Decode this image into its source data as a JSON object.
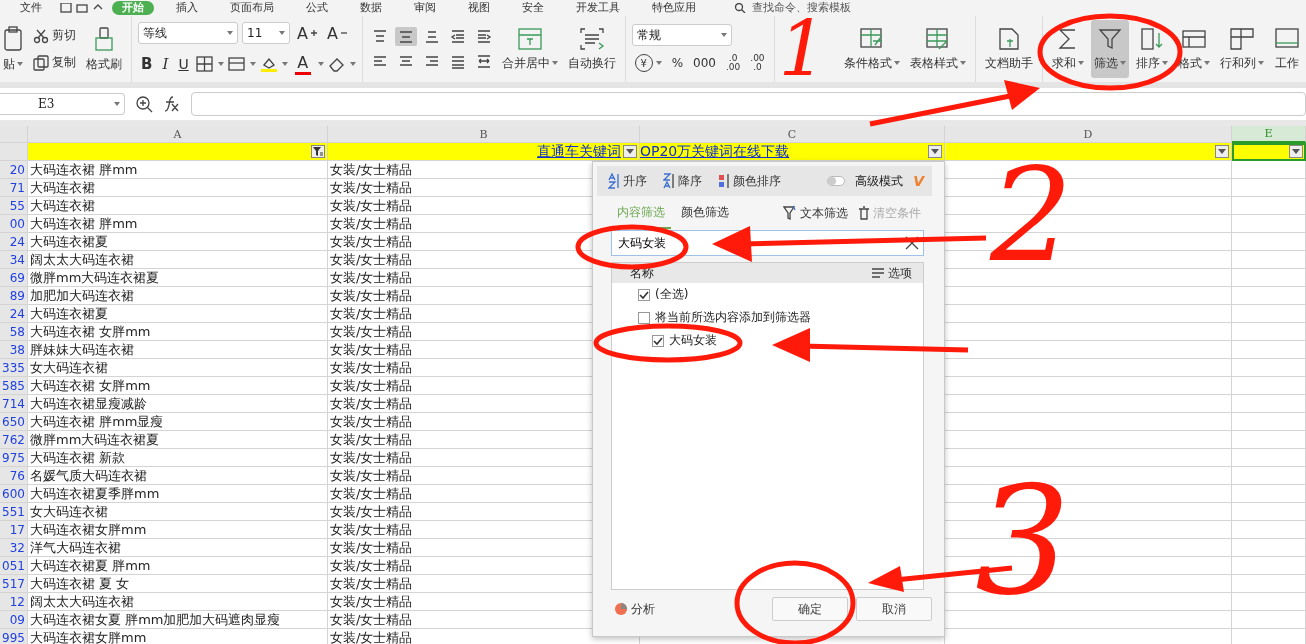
{
  "menu_bar": {
    "file": "文件",
    "tabs": [
      {
        "label": "开始",
        "selected": true
      },
      {
        "label": "插入",
        "selected": false
      },
      {
        "label": "页面布局",
        "selected": false
      },
      {
        "label": "公式",
        "selected": false
      },
      {
        "label": "数据",
        "selected": false
      },
      {
        "label": "审阅",
        "selected": false
      },
      {
        "label": "视图",
        "selected": false
      },
      {
        "label": "安全",
        "selected": false
      },
      {
        "label": "开发工具",
        "selected": false
      },
      {
        "label": "特色应用",
        "selected": false
      }
    ],
    "search_placeholder": "查找命令、搜索模板"
  },
  "ribbon": {
    "paste": "贴",
    "cut": "剪切",
    "copy": "复制",
    "format_painter": "格式刷",
    "font": "等线",
    "size": "11",
    "grow_font": "A",
    "shrink_font": "A",
    "font_style_buttons": [
      "B",
      "I",
      "U"
    ],
    "font_color": "A",
    "align_buttons": [
      {
        "selected": false
      },
      {
        "selected": true
      },
      {
        "selected": false
      },
      {
        "selected": false
      },
      {
        "selected": false
      },
      {
        "selected": false
      },
      {
        "selected": false
      },
      {
        "selected": false
      },
      {
        "selected": false
      },
      {
        "selected": false
      }
    ],
    "merge": "合并居中",
    "wrap": "自动换行",
    "number_format": "常规",
    "number_buttons": [
      {
        "kind": "currency",
        "label": "¥"
      },
      {
        "kind": "plain",
        "label": "%"
      },
      {
        "kind": "plain",
        "label": "000"
      },
      {
        "kind": "stack",
        "lines": [
          ".0",
          ".00"
        ]
      },
      {
        "kind": "stack",
        "lines": [
          ".00",
          ".0"
        ]
      }
    ],
    "tools": [
      {
        "label": "条件格式",
        "caret": true,
        "selected": false
      },
      {
        "label": "表格样式",
        "caret": true,
        "selected": false
      },
      {
        "label": "文档助手",
        "caret": false,
        "selected": false
      },
      {
        "label": "求和",
        "caret": true,
        "selected": false
      },
      {
        "label": "筛选",
        "caret": true,
        "selected": true
      },
      {
        "label": "排序",
        "caret": true,
        "selected": false
      },
      {
        "label": "格式",
        "caret": true,
        "selected": false
      },
      {
        "label": "行和列",
        "caret": true,
        "selected": false
      },
      {
        "label": "工作",
        "caret": false,
        "selected": false
      }
    ]
  },
  "formula_bar": {
    "name_box": "E3"
  },
  "sheet": {
    "columns": [
      {
        "label": "A",
        "selected": false
      },
      {
        "label": "B",
        "selected": false
      },
      {
        "label": "C",
        "selected": false
      },
      {
        "label": "D",
        "selected": false
      },
      {
        "label": "E",
        "selected": true
      }
    ],
    "title_row": {
      "left": "直通车关键词",
      "right": "OP20万关键词在线下载"
    },
    "rows": [
      {
        "number": "20",
        "keyword": "大码连衣裙 胖mm",
        "category": "女装/女士精品"
      },
      {
        "number": "71",
        "keyword": "大码连衣裙",
        "category": "女装/女士精品"
      },
      {
        "number": "55",
        "keyword": "大码连衣裙",
        "category": "女装/女士精品"
      },
      {
        "number": "00",
        "keyword": "大码连衣裙 胖mm",
        "category": "女装/女士精品"
      },
      {
        "number": "24",
        "keyword": "大码连衣裙夏",
        "category": "女装/女士精品"
      },
      {
        "number": "34",
        "keyword": "阔太太大码连衣裙",
        "category": "女装/女士精品"
      },
      {
        "number": "69",
        "keyword": "微胖mm大码连衣裙夏",
        "category": "女装/女士精品"
      },
      {
        "number": "89",
        "keyword": "加肥加大码连衣裙",
        "category": "女装/女士精品"
      },
      {
        "number": "24",
        "keyword": "大码连衣裙夏",
        "category": "女装/女士精品"
      },
      {
        "number": "58",
        "keyword": "大码连衣裙 女胖mm",
        "category": "女装/女士精品"
      },
      {
        "number": "38",
        "keyword": "胖妹妹大码连衣裙",
        "category": "女装/女士精品"
      },
      {
        "number": "335",
        "keyword": "女大码连衣裙",
        "category": "女装/女士精品"
      },
      {
        "number": "585",
        "keyword": "大码连衣裙 女胖mm",
        "category": "女装/女士精品"
      },
      {
        "number": "714",
        "keyword": "大码连衣裙显瘦减龄",
        "category": "女装/女士精品"
      },
      {
        "number": "650",
        "keyword": "大码连衣裙 胖mm显瘦",
        "category": "女装/女士精品"
      },
      {
        "number": "762",
        "keyword": "微胖mm大码连衣裙夏",
        "category": "女装/女士精品"
      },
      {
        "number": "975",
        "keyword": "大码连衣裙 新款",
        "category": "女装/女士精品"
      },
      {
        "number": "76",
        "keyword": "名媛气质大码连衣裙",
        "category": "女装/女士精品"
      },
      {
        "number": "600",
        "keyword": "大码连衣裙夏季胖mm",
        "category": "女装/女士精品"
      },
      {
        "number": "551",
        "keyword": "女大码连衣裙",
        "category": "女装/女士精品"
      },
      {
        "number": "17",
        "keyword": "大码连衣裙女胖mm",
        "category": "女装/女士精品"
      },
      {
        "number": "32",
        "keyword": "洋气大码连衣裙",
        "category": "女装/女士精品"
      },
      {
        "number": "051",
        "keyword": "大码连衣裙夏 胖mm",
        "category": "女装/女士精品"
      },
      {
        "number": "517",
        "keyword": "大码连衣裙 夏 女",
        "category": "女装/女士精品"
      },
      {
        "number": "12",
        "keyword": "阔太太大码连衣裙",
        "category": "女装/女士精品"
      },
      {
        "number": "09",
        "keyword": "大码连衣裙女夏 胖mm加肥加大码遮肉显瘦",
        "category": "女装/女士精品"
      },
      {
        "number": "995",
        "keyword": "大码连衣裙女胖mm",
        "category": "女装/女士精品"
      }
    ]
  },
  "filter_panel": {
    "sort_buttons": [
      "升序",
      "降序",
      "颜色排序"
    ],
    "advanced_mode": {
      "label": "高级模式",
      "on": false
    },
    "vip_badge": "V",
    "tabs": [
      {
        "label": "内容筛选",
        "selected": true
      },
      {
        "label": "颜色筛选",
        "selected": false
      }
    ],
    "text_filter": "文本筛选",
    "clear": {
      "label": "清空条件",
      "disabled": true
    },
    "search_value": "大码女装",
    "list_header": "名称",
    "options": "选项",
    "items": [
      {
        "label": "(全选)",
        "checked": true
      },
      {
        "label": "将当前所选内容添加到筛选器",
        "checked": false
      },
      {
        "label": "大码女装",
        "checked": true
      }
    ],
    "analysis": "分析",
    "buttons": [
      "确定",
      "取消"
    ]
  },
  "annotations": [
    {
      "label": "1"
    },
    {
      "label": "2"
    },
    {
      "label": "3"
    }
  ]
}
